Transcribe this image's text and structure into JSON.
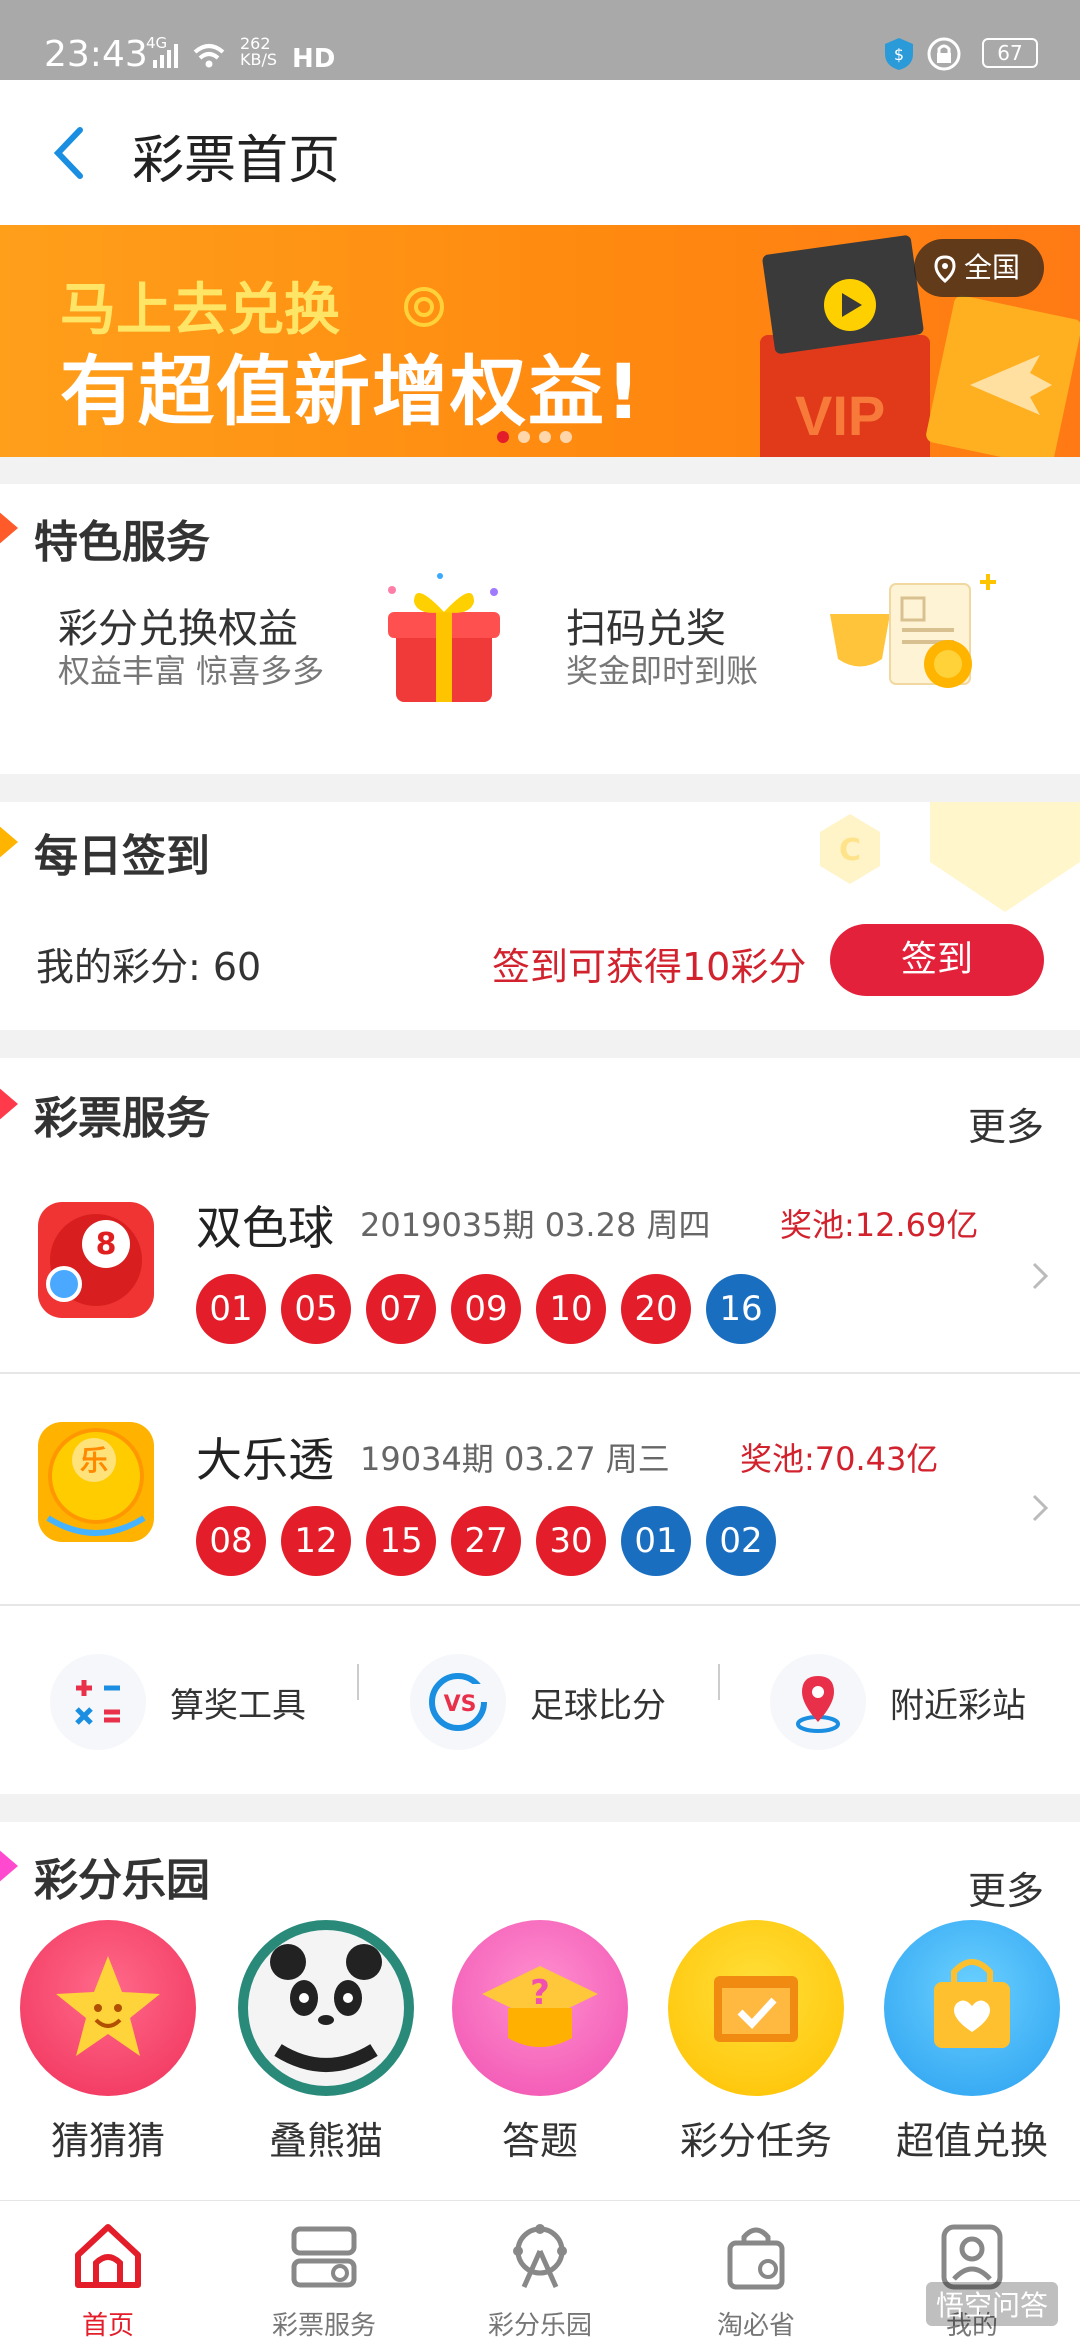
{
  "status_bar": {
    "time": "23:43",
    "net_type": "4G",
    "net_speed": "262 KB/S",
    "hd": "HD",
    "battery": "67"
  },
  "navbar": {
    "title": "彩票首页"
  },
  "banner": {
    "line1": "马上去兑换",
    "line2": "有超值新增权益!",
    "location": "全国",
    "vip_text": "VIP",
    "page_count": 4,
    "active_page": 1
  },
  "featured": {
    "title": "特色服务",
    "items": [
      {
        "title": "彩分兑换权益",
        "subtitle": "权益丰富 惊喜多多"
      },
      {
        "title": "扫码兑奖",
        "subtitle": "奖金即时到账"
      }
    ]
  },
  "checkin": {
    "title": "每日签到",
    "points_label": "我的彩分: 60",
    "reward_text": "签到可获得10彩分",
    "button": "签到"
  },
  "lottery": {
    "title": "彩票服务",
    "more": "更多",
    "items": [
      {
        "name": "双色球",
        "issue": "2019035期 03.28 周四",
        "pool": "奖池:12.69亿",
        "red": [
          "01",
          "05",
          "07",
          "09",
          "10",
          "20"
        ],
        "blue": [
          "16"
        ]
      },
      {
        "name": "大乐透",
        "issue": "19034期 03.27 周三",
        "pool": "奖池:70.43亿",
        "red": [
          "08",
          "12",
          "15",
          "27",
          "30"
        ],
        "blue": [
          "01",
          "02"
        ]
      }
    ]
  },
  "tools": [
    {
      "label": "算奖工具",
      "icon": "calculator-icon"
    },
    {
      "label": "足球比分",
      "icon": "vs-icon"
    },
    {
      "label": "附近彩站",
      "icon": "location-pin-icon"
    }
  ],
  "park": {
    "title": "彩分乐园",
    "more": "更多",
    "items": [
      {
        "label": "猜猜猜",
        "icon": "star-face-icon"
      },
      {
        "label": "叠熊猫",
        "icon": "panda-icon"
      },
      {
        "label": "答题",
        "icon": "question-cap-icon"
      },
      {
        "label": "彩分任务",
        "icon": "task-check-icon"
      },
      {
        "label": "超值兑换",
        "icon": "heart-bag-icon"
      }
    ]
  },
  "tabbar": [
    {
      "label": "首页",
      "icon": "home-icon",
      "active": true
    },
    {
      "label": "彩票服务",
      "icon": "lottery-service-icon"
    },
    {
      "label": "彩分乐园",
      "icon": "ferris-wheel-icon"
    },
    {
      "label": "淘必省",
      "icon": "shopping-bag-icon"
    },
    {
      "label": "我的",
      "icon": "profile-icon"
    }
  ],
  "watermark": "悟空问答",
  "colors": {
    "primary_red": "#e31d2a",
    "ball_blue": "#1a6ec0",
    "banner_orange": "#ff8a10",
    "back_blue": "#1a8ee0"
  }
}
